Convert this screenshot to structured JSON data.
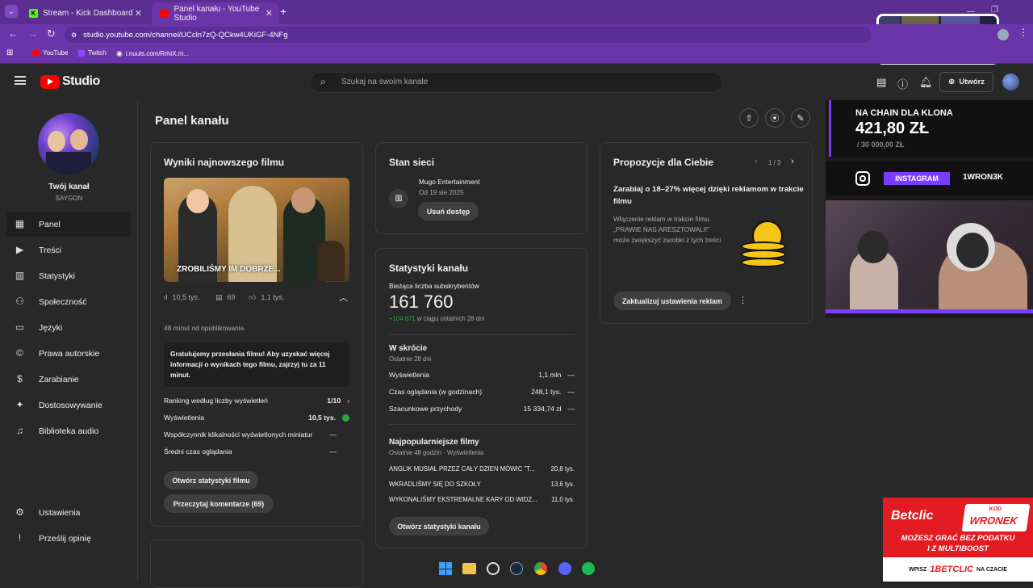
{
  "browser": {
    "tabs": [
      {
        "title": "Stream - Kick Dashboard"
      },
      {
        "title": "Panel kanału - YouTube Studio"
      }
    ],
    "url": "studio.youtube.com/channel/UCcln7zQ-QCkw4UKiGF-4NFg",
    "bookmarks": [
      "YouTube",
      "Twitch",
      "i.nuuls.com/RrhiX.m..."
    ]
  },
  "header": {
    "logo": "Studio",
    "search_placeholder": "Szukaj na swoim kanale",
    "create_label": "Utwórz"
  },
  "sidebar": {
    "channel_label": "Twój kanał",
    "channel_name": "SAYGON",
    "items": [
      {
        "label": "Panel",
        "icon": "dashboard-icon"
      },
      {
        "label": "Treści",
        "icon": "content-icon"
      },
      {
        "label": "Statystyki",
        "icon": "analytics-icon"
      },
      {
        "label": "Społeczność",
        "icon": "community-icon"
      },
      {
        "label": "Języki",
        "icon": "subtitles-icon"
      },
      {
        "label": "Prawa autorskie",
        "icon": "copyright-icon"
      },
      {
        "label": "Zarabianie",
        "icon": "dollar-icon"
      },
      {
        "label": "Dostosowywanie",
        "icon": "customize-icon"
      },
      {
        "label": "Biblioteka audio",
        "icon": "audio-library-icon"
      }
    ],
    "bottom_items": [
      {
        "label": "Ustawienia",
        "icon": "gear-icon"
      },
      {
        "label": "Prześlij opinię",
        "icon": "feedback-icon"
      }
    ]
  },
  "page": {
    "title": "Panel kanału"
  },
  "latest_video": {
    "title": "Wyniki najnowszego filmu",
    "thumb_caption": "ZROBILIŚMY IM DOBRZE...",
    "views": "10,5 tys.",
    "comments": "69",
    "likes": "1,1 tys.",
    "published": "48 minut od opublikowania",
    "note": "Gratulujemy przesłania filmu! Aby uzyskać więcej informacji o wynikach tego filmu, zajrzyj tu za 11 minut.",
    "stats": [
      {
        "label": "Ranking według liczby wyświetleń",
        "value": "1/10"
      },
      {
        "label": "Wyświetlenia",
        "value": "10,5 tys."
      },
      {
        "label": "Współczynnik klikalności wyświetlonych miniatur",
        "value": "—"
      },
      {
        "label": "Średni czas oglądania",
        "value": "—"
      }
    ],
    "btn_stats": "Otwórz statystyki filmu",
    "btn_comments": "Przeczytaj komentarze (69)"
  },
  "network": {
    "title": "Stan sieci",
    "name": "Mugo Entertainment",
    "since": "Od 19 sie 2025",
    "btn": "Usuń dostęp"
  },
  "channel_stats": {
    "title": "Statystyki kanału",
    "subs_label": "Bieżąca liczba subskrybentów",
    "subs": "161 760",
    "subs_delta": "+104 671",
    "subs_delta_suffix": " w ciągu ostatnich 28 dni",
    "summary_title": "W skrócie",
    "summary_sub": "Ostatnie 28 dni",
    "summary": [
      {
        "label": "Wyświetlenia",
        "value": "1,1 mln",
        "trend": "—"
      },
      {
        "label": "Czas oglądania (w godzinach)",
        "value": "248,1 tys.",
        "trend": "—"
      },
      {
        "label": "Szacunkowe przychody",
        "value": "15 334,74 zł",
        "trend": "—"
      }
    ],
    "popular_title": "Najpopularniejsze filmy",
    "popular_sub": "Ostatnie 48 godzin · Wyświetlenia",
    "popular": [
      {
        "title": "ANGLIK MUSIAŁ PRZEZ CAŁY DZIEN MÓWIC \"T...",
        "value": "20,8 tys."
      },
      {
        "title": "WKRADLIŚMY SIĘ DO SZKOŁY",
        "value": "13,6 tys."
      },
      {
        "title": "WYKONALIŚMY EKSTREMALNE KARY OD WIDZ...",
        "value": "11,0 tys."
      }
    ],
    "btn": "Otwórz statystyki kanału"
  },
  "suggestions": {
    "title": "Propozycje dla Ciebie",
    "pager": "1 / 3",
    "headline": "Zarabiaj o 18–27% więcej dzięki reklamom w trakcie filmu",
    "body": "Włączenie reklam w trakcie filmu „PRAWIE NAS ARESZTOWALI!” może zwiększyć zarobki z tych treści",
    "btn": "Zaktualizuj ustawienia reklam"
  },
  "overlay": {
    "goal_title": "NA CHAIN DLA KLONA",
    "goal_amount": "421,80 ZŁ",
    "goal_target": "/ 30 000,00 ZŁ",
    "instagram_label": "INSTAGRAM",
    "instagram_handle": "1WRON3K",
    "betclic_brand": "Betclic",
    "betclic_kod": "KOD",
    "betclic_code": "WRONEK",
    "betclic_line1": "MOŻESZ GRAĆ BEZ PODATKU",
    "betclic_line2": "I Z MULTIBOOST",
    "betclic_footer_a": "WPISZ",
    "betclic_footer_b": "1BETCLIC",
    "betclic_footer_c": "NA CZACIE"
  },
  "colors": {
    "brand_red": "#ff0000",
    "positive": "#2ba640",
    "purple": "#6a35a8",
    "gold": "#f5c518"
  }
}
